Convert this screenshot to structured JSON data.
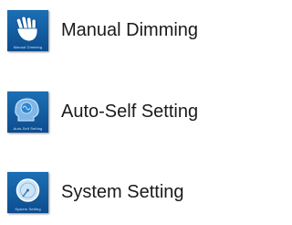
{
  "menu": {
    "items": [
      {
        "label": "Manual Dimming",
        "icon": "hand-icon",
        "icon_caption": "Manual Dimming"
      },
      {
        "label": "Auto-Self Setting",
        "icon": "head-brain-icon",
        "icon_caption": "Auto-Self Setting"
      },
      {
        "label": "System Setting",
        "icon": "dial-icon",
        "icon_caption": "System Setting"
      }
    ]
  },
  "colors": {
    "tile_top": "#1c6fb5",
    "tile_bottom": "#0c4d8f",
    "label_text": "#1a1a1a"
  }
}
